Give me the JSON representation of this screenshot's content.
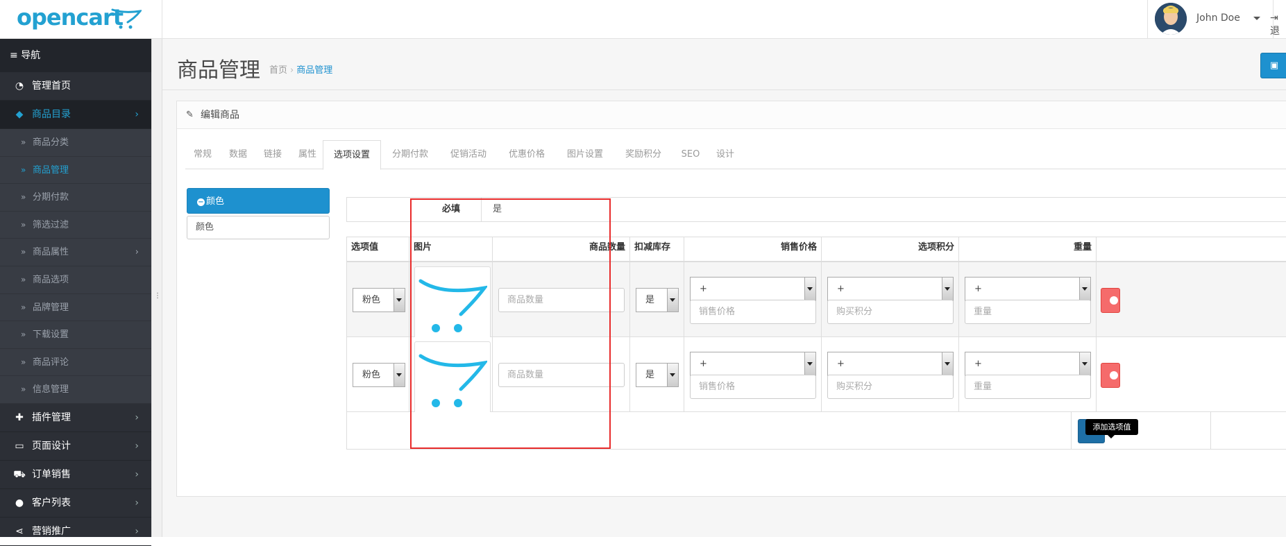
{
  "header": {
    "logo_text": "opencart",
    "user_name": "John Doe",
    "logout_label": "退"
  },
  "nav": {
    "title": "导航",
    "items": [
      {
        "label": "管理首页",
        "icon": "dashboard-icon"
      },
      {
        "label": "商品目录",
        "icon": "tags-icon",
        "active": true
      },
      {
        "label": "插件管理",
        "icon": "puzzle-icon"
      },
      {
        "label": "页面设计",
        "icon": "monitor-icon"
      },
      {
        "label": "订单销售",
        "icon": "cart-icon"
      },
      {
        "label": "客户列表",
        "icon": "user-icon"
      },
      {
        "label": "营销推广",
        "icon": "share-icon"
      }
    ],
    "catalog_sub": [
      {
        "label": "商品分类"
      },
      {
        "label": "商品管理",
        "active": true
      },
      {
        "label": "分期付款"
      },
      {
        "label": "筛选过滤"
      },
      {
        "label": "商品属性"
      },
      {
        "label": "商品选项"
      },
      {
        "label": "品牌管理"
      },
      {
        "label": "下载设置"
      },
      {
        "label": "商品评论"
      },
      {
        "label": "信息管理"
      }
    ]
  },
  "page": {
    "title": "商品管理",
    "breadcrumb_home": "首页",
    "breadcrumb_current": "商品管理"
  },
  "panel": {
    "heading": "编辑商品",
    "tabs": [
      "常规",
      "数据",
      "链接",
      "属性",
      "选项设置",
      "分期付款",
      "促销活动",
      "优惠价格",
      "图片设置",
      "奖励积分",
      "SEO",
      "设计"
    ],
    "active_tab": "选项设置"
  },
  "option": {
    "active_name": "颜色",
    "name_input": "颜色",
    "required_label": "必填",
    "required_value": "是"
  },
  "table": {
    "headers": [
      "选项值",
      "图片",
      "商品数量",
      "扣减库存",
      "销售价格",
      "选项积分",
      "重量"
    ],
    "rows": [
      {
        "option_value": "粉色",
        "quantity_placeholder": "商品数量",
        "subtract": "是",
        "price_prefix": "+",
        "price_placeholder": "销售价格",
        "points_prefix": "+",
        "points_placeholder": "购买积分",
        "weight_prefix": "+",
        "weight_placeholder": "重量"
      },
      {
        "option_value": "粉色",
        "quantity_placeholder": "商品数量",
        "subtract": "是",
        "price_prefix": "+",
        "price_placeholder": "销售价格",
        "points_prefix": "+",
        "points_placeholder": "购买积分",
        "weight_prefix": "+",
        "weight_placeholder": "重量"
      }
    ],
    "add_tooltip": "添加选项值"
  },
  "colors": {
    "brand": "#23a1d1",
    "primary": "#1e91cf",
    "danger": "#f56b6b",
    "sidebar": "#2c2f36",
    "highlight": "#e82a2a"
  }
}
